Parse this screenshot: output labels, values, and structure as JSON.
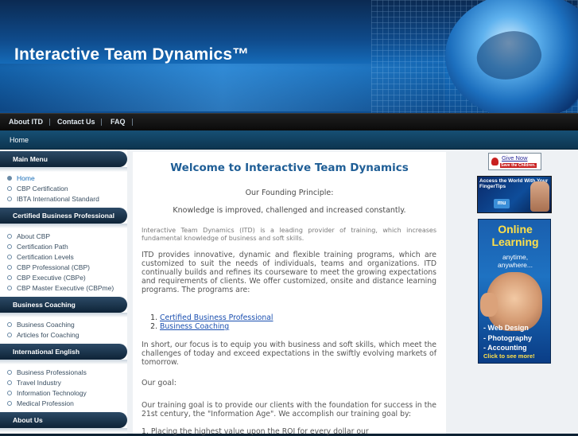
{
  "header": {
    "site_title": "Interactive Team Dynamics™"
  },
  "topnav": {
    "items": [
      "About ITD",
      "Contact Us",
      "FAQ"
    ]
  },
  "breadcrumb": {
    "label": "Home"
  },
  "sidebar": {
    "sections": [
      {
        "title": "Main Menu",
        "items": [
          "Home",
          "CBP Certification",
          "IBTA International Standard"
        ]
      },
      {
        "title": "Certified Business Professional",
        "items": [
          "About CBP",
          "Certification Path",
          "Certification Levels",
          "CBP Professional (CBP)",
          "CBP Executive (CBPe)",
          "CBP Master Executive (CBPme)"
        ]
      },
      {
        "title": "Business Coaching",
        "items": [
          "Business Coaching",
          "Articles for Coaching"
        ]
      },
      {
        "title": "International English",
        "items": [
          "Business Professionals",
          "Travel Industry",
          "Information Technology",
          "Medical Profession"
        ]
      },
      {
        "title": "About Us",
        "items": []
      }
    ],
    "active_item": "Home"
  },
  "main": {
    "heading": "Welcome to Interactive Team Dynamics",
    "principle_label": "Our Founding Principle:",
    "motto": "Knowledge is improved, challenged and increased constantly.",
    "intro": "Interactive Team Dynamics (ITD) is a leading provider of training, which increases fundamental knowledge of business and soft skills.",
    "programs_para": "ITD provides innovative, dynamic and flexible training programs, which are customized to suit the needs of individuals, teams and organizations. ITD continually builds and refines its courseware to meet the growing expectations and requirements of clients. We offer customized, onsite and distance learning programs. The programs are:",
    "programs": [
      "Certified Business Professional",
      "Business Coaching"
    ],
    "focus_para": "In short, our focus is to equip you with business and soft skills, which meet the challenges of today and exceed expectations in the swiftly evolving markets of tomorrow.",
    "goal_heading": "Our goal:",
    "goal_para": "Our training goal is to provide our clients with the foundation for success in the 21st century, the \"Information Age\". We accomplish our training goal by:",
    "goal_item_1": "1. Placing the highest value upon the ROI for every dollar our"
  },
  "right": {
    "givenow_top": "Give Now",
    "givenow_bottom": "Save the Children.",
    "access_text": "Access the World With Your FingerTips",
    "access_badge": "mu",
    "online_title_1": "Online",
    "online_title_2": "Learning",
    "online_sub_1": "anytime,",
    "online_sub_2": "anywhere...",
    "online_list": [
      "- Web Design",
      "- Photography",
      "- Accounting"
    ],
    "online_cta": "Click to see more!"
  }
}
